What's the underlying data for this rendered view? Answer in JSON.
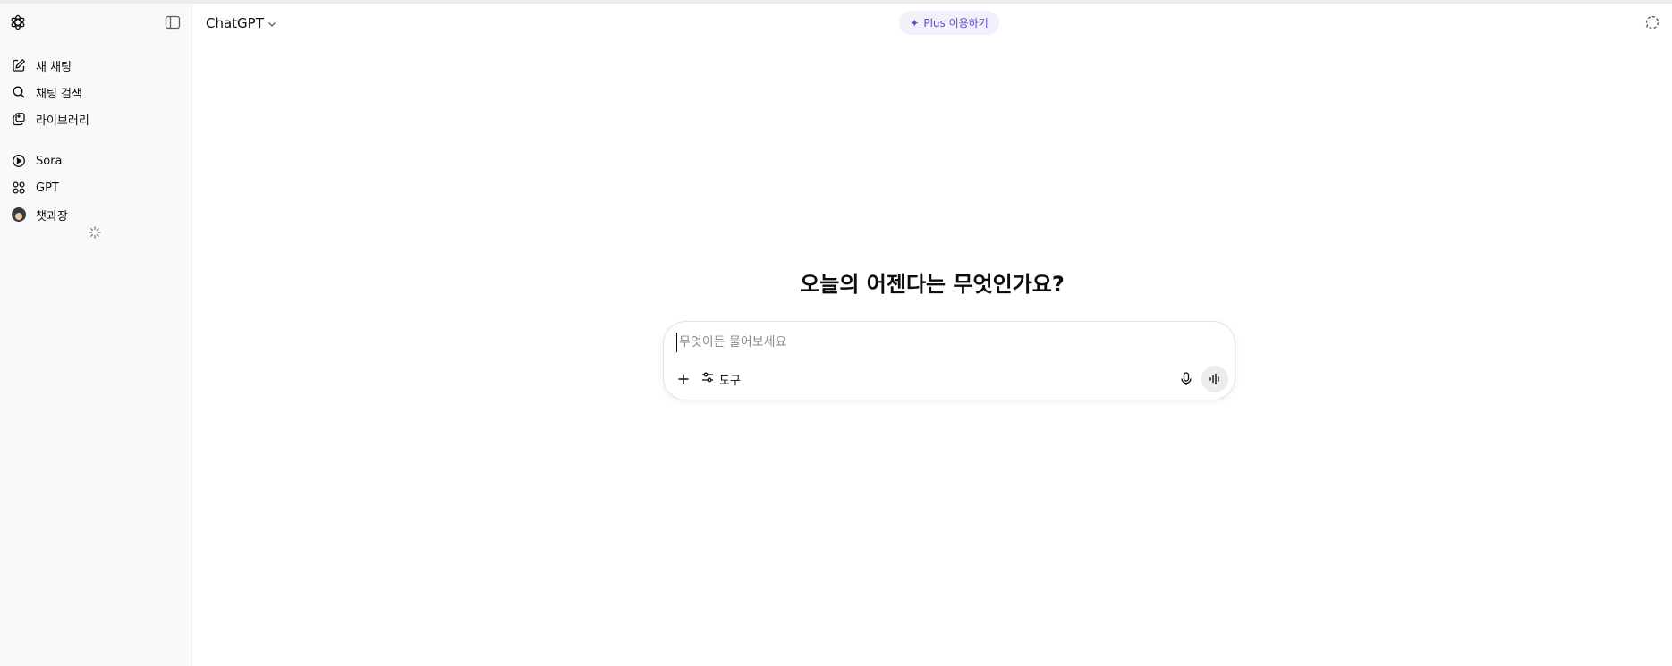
{
  "sidebar": {
    "logo_icon": "openai-logo-icon",
    "toggle_icon": "sidebar-toggle-icon",
    "items": [
      {
        "label": "새 채팅",
        "icon": "edit-icon"
      },
      {
        "label": "채팅 검색",
        "icon": "search-icon"
      },
      {
        "label": "라이브러리",
        "icon": "library-icon"
      },
      {
        "label": "Sora",
        "icon": "play-circle-icon"
      },
      {
        "label": "GPT",
        "icon": "grid-icon"
      },
      {
        "label": "챗과장",
        "icon": "avatar"
      }
    ],
    "loading_icon": "spinner-icon"
  },
  "header": {
    "model_name": "ChatGPT",
    "upgrade_label": "Plus 이용하기",
    "upgrade_icon": "sparkle-icon",
    "temp_chat_icon": "temporary-chat-icon"
  },
  "main": {
    "headline": "오늘의 어젠다는 무엇인가요?"
  },
  "composer": {
    "placeholder": "무엇이든 물어보세요",
    "value": "",
    "tools_label": "도구",
    "add_icon": "plus-icon",
    "tools_icon": "sliders-icon",
    "mic_icon": "mic-icon",
    "voice_icon": "voice-mode-icon"
  },
  "colors": {
    "sidebar_bg": "#f9f9f9",
    "accent": "#5b4fd1",
    "pill_bg": "#f1f0fb"
  }
}
